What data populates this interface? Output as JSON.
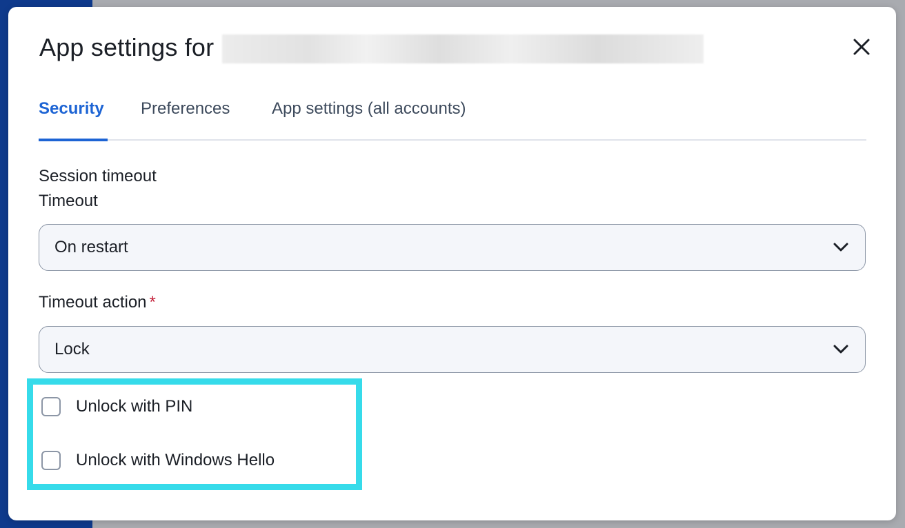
{
  "dialog": {
    "title": "App settings for",
    "close_icon": "close-icon"
  },
  "tabs": [
    {
      "label": "Security",
      "active": true
    },
    {
      "label": "Preferences",
      "active": false
    },
    {
      "label": "App settings (all accounts)",
      "active": false
    }
  ],
  "security": {
    "section_title": "Session timeout",
    "timeout": {
      "label": "Timeout",
      "value": "On restart"
    },
    "timeout_action": {
      "label": "Timeout action",
      "required_marker": "*",
      "value": "Lock"
    },
    "unlock_options": [
      {
        "label": "Unlock with PIN",
        "checked": false
      },
      {
        "label": "Unlock with Windows Hello",
        "checked": false
      }
    ]
  },
  "colors": {
    "accent": "#1d64d4",
    "highlight": "#36dbea",
    "required": "#c4213a"
  }
}
